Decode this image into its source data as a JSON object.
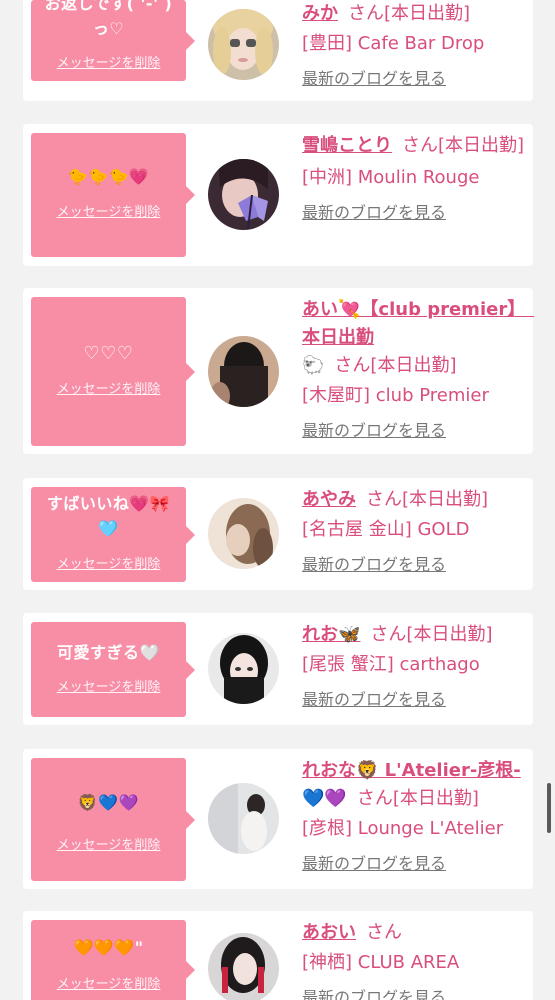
{
  "items": [
    {
      "bubble_lines": [
        "お返しです( '-' )",
        "っ♡"
      ],
      "delete_label": "メッセージを削除",
      "name": "みか",
      "name_cont": "",
      "san": "さん[本日出勤]",
      "shop": "[豊田] Cafe Bar Drop",
      "blog": "最新のブログを見る"
    },
    {
      "bubble_lines": [
        "🐤🐤🐤💗"
      ],
      "delete_label": "メッセージを削除",
      "name": "雪嶋ことり",
      "name_cont": "",
      "san": "さん[本日出勤]",
      "shop": "[中洲] Moulin Rouge",
      "blog": "最新のブログを見る"
    },
    {
      "bubble_lines": [
        "♡♡♡"
      ],
      "delete_label": "メッセージを削除",
      "name": "あい💘【club premier】　本日出勤",
      "name_cont": "🐑",
      "san": "さん[本日出勤]",
      "shop": "[木屋町] club Premier",
      "blog": "最新のブログを見る"
    },
    {
      "bubble_lines": [
        "すばいいね💗🎀",
        "🩵"
      ],
      "delete_label": "メッセージを削除",
      "name": "あやみ",
      "name_cont": "",
      "san": "さん[本日出勤]",
      "shop": "[名古屋 金山] GOLD",
      "blog": "最新のブログを見る"
    },
    {
      "bubble_lines": [
        "可愛すぎる🤍"
      ],
      "delete_label": "メッセージを削除",
      "name": "れお🦋",
      "name_cont": "",
      "san": "さん[本日出勤]",
      "shop": "[尾張 蟹江] carthago",
      "blog": "最新のブログを見る"
    },
    {
      "bubble_lines": [
        "🦁💙💜"
      ],
      "delete_label": "メッセージを削除",
      "name": "れおな🦁 L'Atelier-彦根-",
      "name_cont": "💙💜",
      "san": "さん[本日出勤]",
      "shop": "[彦根] Lounge L'Atelier",
      "blog": "最新のブログを見る"
    },
    {
      "bubble_lines": [
        "🧡🧡🧡\""
      ],
      "delete_label": "メッセージを削除",
      "name": "あおい",
      "name_cont": "",
      "san": "さん",
      "shop": "[神栖] CLUB AREA",
      "blog": "最新のブログを見る"
    }
  ],
  "colors": {
    "accent": "#d94e7e",
    "bubble": "#f88ea6",
    "background": "#f2f2f2"
  }
}
